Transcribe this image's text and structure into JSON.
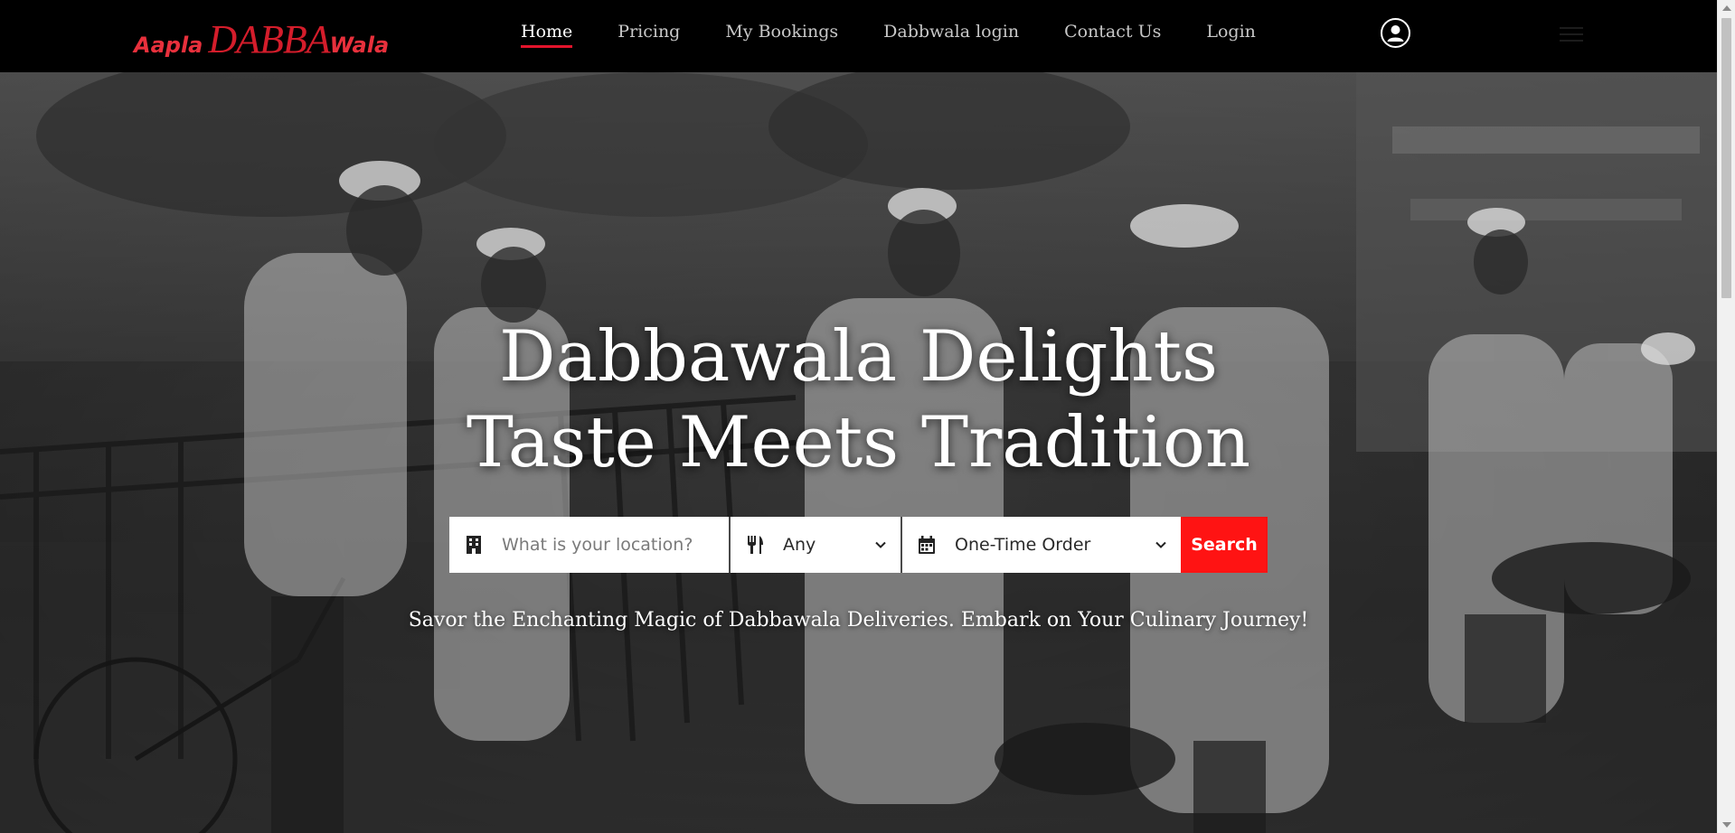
{
  "nav": {
    "logo": {
      "part1": "Aapla",
      "part2": "DABBA",
      "part3": "Wala"
    },
    "links": [
      {
        "label": "Home",
        "active": true
      },
      {
        "label": "Pricing",
        "active": false
      },
      {
        "label": "My Bookings",
        "active": false
      },
      {
        "label": "Dabbwala login",
        "active": false
      },
      {
        "label": "Contact Us",
        "active": false
      },
      {
        "label": "Login",
        "active": false
      }
    ],
    "profile_icon": "user-circle-icon",
    "menu_icon": "hamburger-menu-icon"
  },
  "hero": {
    "title_line1": "Dabbawala Delights",
    "title_line2": "Taste Meets Tradition",
    "search": {
      "location_placeholder": "What is your location?",
      "location_icon": "building-icon",
      "food_type_value": "Any",
      "food_type_icon": "fork-knife-icon",
      "plan_value": "One-Time Order",
      "plan_icon": "calendar-icon",
      "button_label": "Search"
    },
    "tagline": "Savor the Enchanting Magic of Dabbawala Deliveries. Embark on Your Culinary Journey!"
  },
  "colors": {
    "navbar_bg": "#000000",
    "logo_red": "#d41d2b",
    "active_underline": "#e3142c",
    "search_button": "#ff1313",
    "hero_text": "#ffffff"
  }
}
